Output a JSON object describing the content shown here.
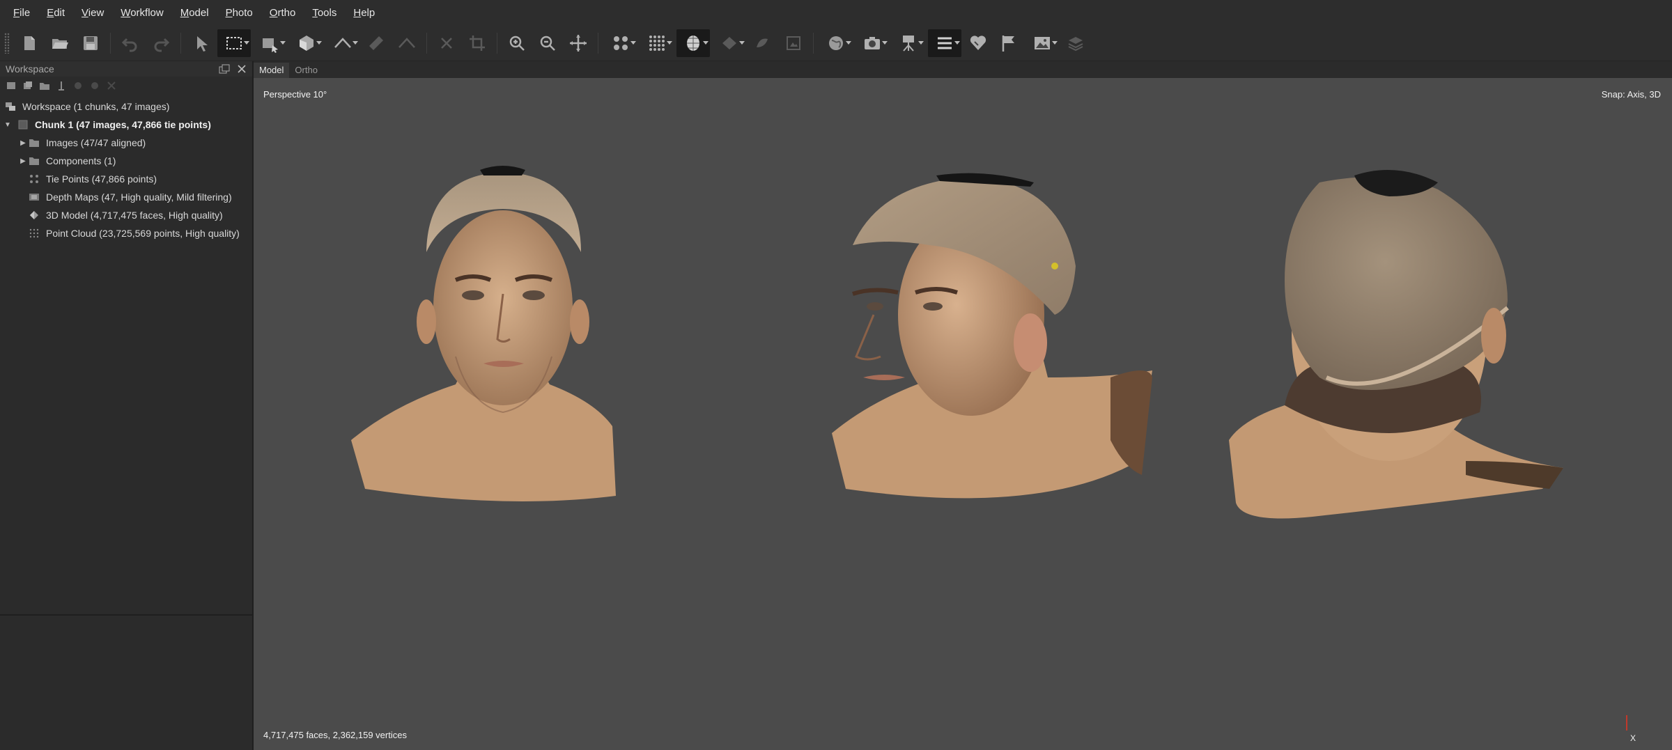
{
  "menu": [
    {
      "mnemonic": "F",
      "rest": "ile"
    },
    {
      "mnemonic": "E",
      "rest": "dit"
    },
    {
      "mnemonic": "V",
      "rest": "iew"
    },
    {
      "mnemonic": "W",
      "rest": "orkflow"
    },
    {
      "mnemonic": "M",
      "rest": "odel"
    },
    {
      "mnemonic": "P",
      "rest": "hoto"
    },
    {
      "mnemonic": "O",
      "rest": "rtho"
    },
    {
      "mnemonic": "T",
      "rest": "ools"
    },
    {
      "mnemonic": "H",
      "rest": "elp"
    }
  ],
  "workspace": {
    "title": "Workspace",
    "tree": [
      {
        "text": "Workspace (1 chunks, 47 images)"
      },
      {
        "text": "Chunk 1 (47 images, 47,866 tie points)"
      },
      {
        "text": "Images (47/47 aligned)"
      },
      {
        "text": "Components (1)"
      },
      {
        "text": "Tie Points (47,866 points)"
      },
      {
        "text": "Depth Maps (47, High quality, Mild filtering)"
      },
      {
        "text": "3D Model (4,717,475 faces, High quality)"
      },
      {
        "text": "Point Cloud (23,725,569 points, High quality)"
      }
    ]
  },
  "tabs": {
    "model": "Model",
    "ortho": "Ortho"
  },
  "viewport": {
    "projection": "Perspective 10°",
    "snap": "Snap: Axis, 3D",
    "stats": "4,717,475 faces, 2,362,159 vertices",
    "axis_label": "X"
  },
  "colors": {
    "accent": "#3a3a3a",
    "background": "#4b4b4b",
    "skin": "#c79d78",
    "cap": "#a8957e"
  }
}
